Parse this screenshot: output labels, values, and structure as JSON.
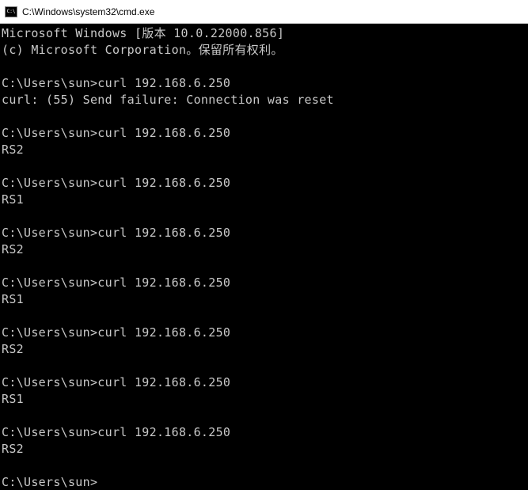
{
  "titlebar": {
    "title": "C:\\Windows\\system32\\cmd.exe"
  },
  "terminal": {
    "lines": [
      "Microsoft Windows [版本 10.0.22000.856]",
      "(c) Microsoft Corporation。保留所有权利。",
      "",
      "C:\\Users\\sun>curl 192.168.6.250",
      "curl: (55) Send failure: Connection was reset",
      "",
      "C:\\Users\\sun>curl 192.168.6.250",
      "RS2",
      "",
      "C:\\Users\\sun>curl 192.168.6.250",
      "RS1",
      "",
      "C:\\Users\\sun>curl 192.168.6.250",
      "RS2",
      "",
      "C:\\Users\\sun>curl 192.168.6.250",
      "RS1",
      "",
      "C:\\Users\\sun>curl 192.168.6.250",
      "RS2",
      "",
      "C:\\Users\\sun>curl 192.168.6.250",
      "RS1",
      "",
      "C:\\Users\\sun>curl 192.168.6.250",
      "RS2",
      "",
      "C:\\Users\\sun>"
    ]
  }
}
